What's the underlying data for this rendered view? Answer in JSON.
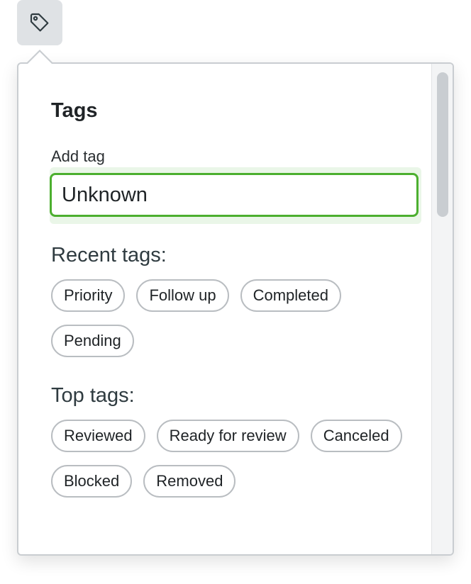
{
  "trigger": {
    "icon": "tag-icon"
  },
  "popover": {
    "title": "Tags",
    "input": {
      "label": "Add tag",
      "value": "Unknown",
      "accent_color": "#4caf2f"
    },
    "recent": {
      "heading": "Recent tags:",
      "tags": [
        "Priority",
        "Follow up",
        "Completed",
        "Pending"
      ]
    },
    "top": {
      "heading": "Top tags:",
      "tags": [
        "Reviewed",
        "Ready for review",
        "Canceled",
        "Blocked",
        "Removed"
      ]
    }
  }
}
